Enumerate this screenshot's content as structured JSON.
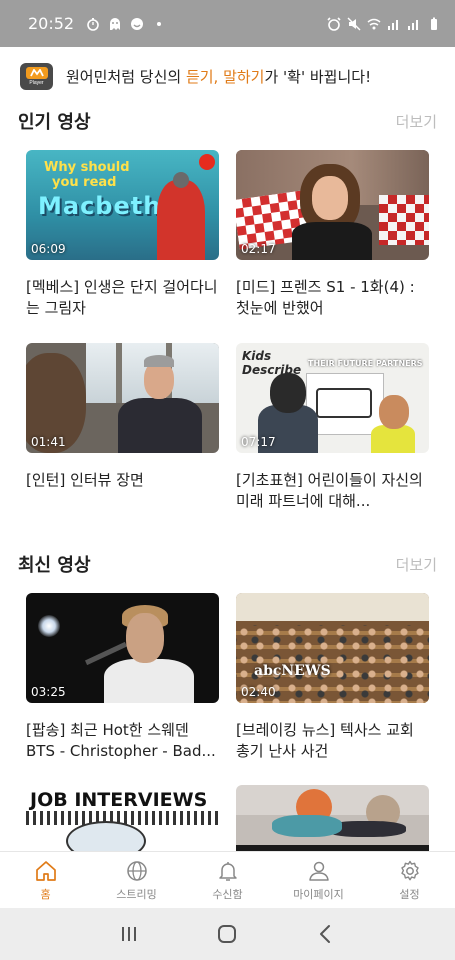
{
  "status_bar": {
    "time": "20:52",
    "icons_left": [
      "timer-icon",
      "ghost-icon",
      "face-icon",
      "dot-icon"
    ],
    "icons_right": [
      "alarm-icon",
      "mute-icon",
      "wifi-icon",
      "signal-icon",
      "signal-icon",
      "battery-icon"
    ]
  },
  "banner": {
    "logo_label": "Player",
    "text_before": "원어민처럼 당신의 ",
    "text_highlight": "듣기, 말하기",
    "text_after": "가 '확' 바뀝니다!",
    "highlight_color": "#e07b18"
  },
  "popular": {
    "title": "인기 영상",
    "more": "더보기",
    "videos": [
      {
        "duration": "06:09",
        "title": "[멕베스] 인생은 단지 걸어다니는 그림자",
        "thumb_text": [
          "Why should",
          "you read",
          "Macbeth?"
        ],
        "badge": "TED-Ed"
      },
      {
        "duration": "02:17",
        "title": "[미드] 프렌즈 S1 - 1화(4) : 첫눈에 반했어"
      },
      {
        "duration": "01:41",
        "title": "[인턴] 인터뷰 장면"
      },
      {
        "duration": "07:17",
        "title": "[기초표현] 어린이들이 자신의 미래 파트너에 대해...",
        "thumb_text": [
          "Kids",
          "Describe",
          "THEIR FUTURE PARTNERS"
        ]
      }
    ]
  },
  "latest": {
    "title": "최신 영상",
    "more": "더보기",
    "videos": [
      {
        "duration": "03:25",
        "title": "[팝송] 최근 Hot한 스웨덴 BTS - Christopher - Bad..."
      },
      {
        "duration": "02:40",
        "title": "[브레이킹 뉴스] 텍사스 교회 총기 난사 사건",
        "thumb_text": "abcNEWS"
      },
      {
        "duration": "",
        "title": "",
        "thumb_text": "JOB INTERVIEWS"
      },
      {
        "duration": "",
        "title": ""
      }
    ]
  },
  "bottom_nav": {
    "active_color": "#e07b18",
    "items": [
      {
        "label": "홈",
        "icon": "home-icon",
        "active": true
      },
      {
        "label": "스트리밍",
        "icon": "globe-icon",
        "active": false
      },
      {
        "label": "수신함",
        "icon": "bell-icon",
        "active": false
      },
      {
        "label": "마이페이지",
        "icon": "person-icon",
        "active": false
      },
      {
        "label": "설정",
        "icon": "gear-icon",
        "active": false
      }
    ]
  },
  "system_nav": {
    "icons": [
      "recent-apps-icon",
      "home-circle-icon",
      "back-icon"
    ]
  }
}
